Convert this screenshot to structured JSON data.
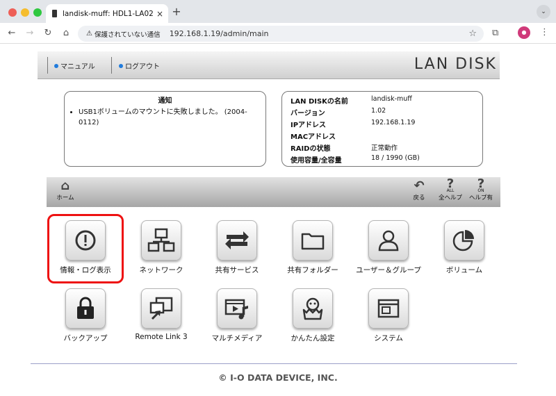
{
  "browser": {
    "tab_title": "landisk-muff: HDL1-LA02",
    "new_tab": "+",
    "close": "×",
    "security_label": "保護されていない通信",
    "url": "192.168.1.19/admin/main"
  },
  "header": {
    "manual": "マニュアル",
    "logout": "ログアウト",
    "brand": "LAN DISK"
  },
  "notice": {
    "title": "通知",
    "items": [
      "USB1ボリュームのマウントに失敗しました。 (2004-0112)"
    ]
  },
  "device_info": {
    "rows": [
      {
        "label": "LAN DISKの名前",
        "value": "landisk-muff"
      },
      {
        "label": "バージョン",
        "value": "1.02"
      },
      {
        "label": "IPアドレス",
        "value": "192.168.1.19"
      },
      {
        "label": "MACアドレス",
        "value": ""
      },
      {
        "label": "RAIDの状態",
        "value": "正常動作"
      },
      {
        "label": "使用容量/全容量",
        "value": "18 / 1990 (GB)"
      }
    ]
  },
  "navbar": {
    "home": "ホーム",
    "back": "戻る",
    "all_help": "全ヘルプ",
    "help_on": "ヘルプ有",
    "all_sub": "ALL",
    "on_sub": "ON"
  },
  "menu": [
    {
      "label": "情報・ログ表示",
      "icon": "info-icon"
    },
    {
      "label": "ネットワーク",
      "icon": "network-icon"
    },
    {
      "label": "共有サービス",
      "icon": "arrows-icon"
    },
    {
      "label": "共有フォルダー",
      "icon": "folder-icon"
    },
    {
      "label": "ユーザー＆グループ",
      "icon": "user-icon"
    },
    {
      "label": "ボリューム",
      "icon": "pie-icon"
    },
    {
      "label": "バックアップ",
      "icon": "lock-icon"
    },
    {
      "label": "Remote Link 3",
      "icon": "remote-link-icon"
    },
    {
      "label": "マルチメディア",
      "icon": "multimedia-icon"
    },
    {
      "label": "かんたん設定",
      "icon": "chick-icon"
    },
    {
      "label": "システム",
      "icon": "window-icon"
    }
  ],
  "footer": {
    "copyright": "© I-O DATA DEVICE, INC."
  },
  "colors": {
    "highlight": "#ee1111",
    "bullet": "#1f7bdc"
  }
}
